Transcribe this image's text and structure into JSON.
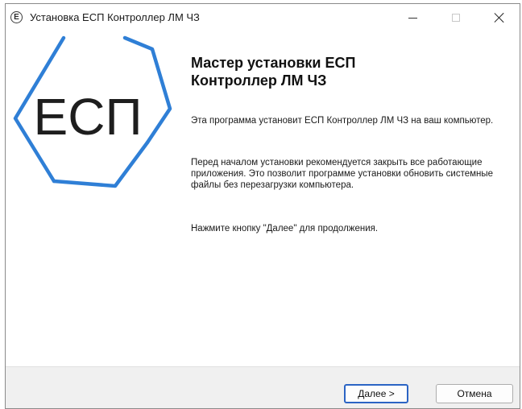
{
  "window": {
    "title": "Установка ЕСП Контроллер ЛМ ЧЗ",
    "app_icon_letter": "Е"
  },
  "banner": {
    "logo_text": "ЕСП",
    "accent_color": "#2f7fd6"
  },
  "content": {
    "heading_line1": "Мастер установки ЕСП",
    "heading_line2": "Контроллер ЛМ ЧЗ",
    "paragraph1": "Эта программа установит ЕСП Контроллер ЛМ ЧЗ на ваш компьютер.",
    "paragraph2": "Перед началом установки рекомендуется закрыть все работающие приложения. Это позволит программе установки обновить системные файлы без перезагрузки компьютера.",
    "paragraph3": "Нажмите кнопку \"Далее\" для продолжения."
  },
  "footer": {
    "next_label": "Далее >",
    "cancel_label": "Отмена"
  }
}
